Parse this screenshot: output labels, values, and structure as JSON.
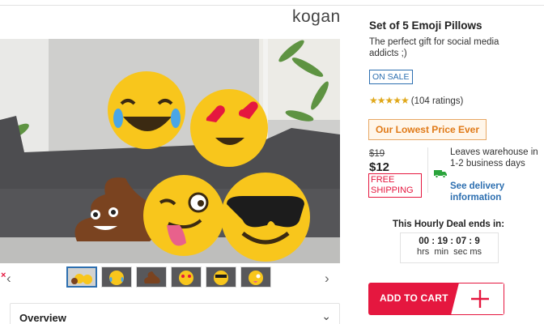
{
  "brand": {
    "logo_text": "kogan"
  },
  "product": {
    "title": "Set of 5 Emoji Pillows",
    "subtitle": "The perfect gift for social media addicts ;)",
    "sale_badge": "ON SALE",
    "star_glyphs": "★★★★★",
    "rating_text": "(104 ratings)",
    "rating_value": 4.5,
    "lowest_price_badge": "Our Lowest Price Ever",
    "old_price": "$19",
    "price": "$12",
    "free_shipping": "FREE SHIPPING",
    "shipping_info": "Leaves warehouse in 1-2 business days",
    "delivery_link": "See delivery information"
  },
  "deal": {
    "label": "This Hourly Deal ends in:",
    "timer": "00 : 19 : 07 : 9",
    "units": "hrs  min  sec ms"
  },
  "cart": {
    "label": "ADD TO CART",
    "plus_icon": "plus-icon"
  },
  "gallery": {
    "thumbnail_count": 6,
    "active_index": 0,
    "prev_glyph": "‹",
    "next_glyph": "›",
    "close_glyph": "×"
  },
  "overview": {
    "label": "Overview",
    "chevron": "⌄"
  },
  "colors": {
    "accent_red": "#e5173f",
    "link_blue": "#2d6fb0",
    "star_gold": "#e0a81b",
    "lowest_orange": "#e07a18",
    "delivery_green": "#2aa43b"
  }
}
